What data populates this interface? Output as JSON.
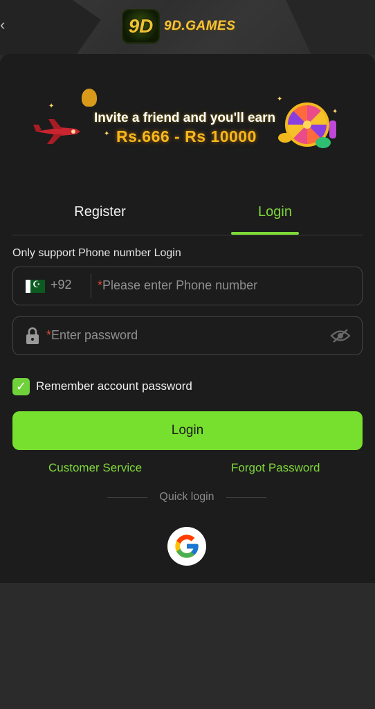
{
  "header": {
    "logo_mark": "9D",
    "logo_text": "9D.GAMES",
    "back_icon": "back-chevron-icon"
  },
  "banner": {
    "line1": "Invite a friend and you'll earn",
    "line2": "Rs.666 - Rs 10000"
  },
  "tabs": [
    {
      "label": "Register",
      "active": false
    },
    {
      "label": "Login",
      "active": true
    }
  ],
  "form": {
    "hint": "Only support Phone number Login",
    "phone": {
      "country_code": "+92",
      "required_mark": "*",
      "placeholder": "Please enter Phone number"
    },
    "password": {
      "required_mark": "*",
      "placeholder": "Enter password"
    },
    "remember": {
      "checked": true,
      "label": "Remember account password"
    },
    "submit_label": "Login",
    "customer_service": "Customer Service",
    "forgot_password": "Forgot Password",
    "quick_login": "Quick login"
  },
  "colors": {
    "accent": "#77e02e",
    "background": "#1c1c1c",
    "required": "#e24a3b"
  }
}
